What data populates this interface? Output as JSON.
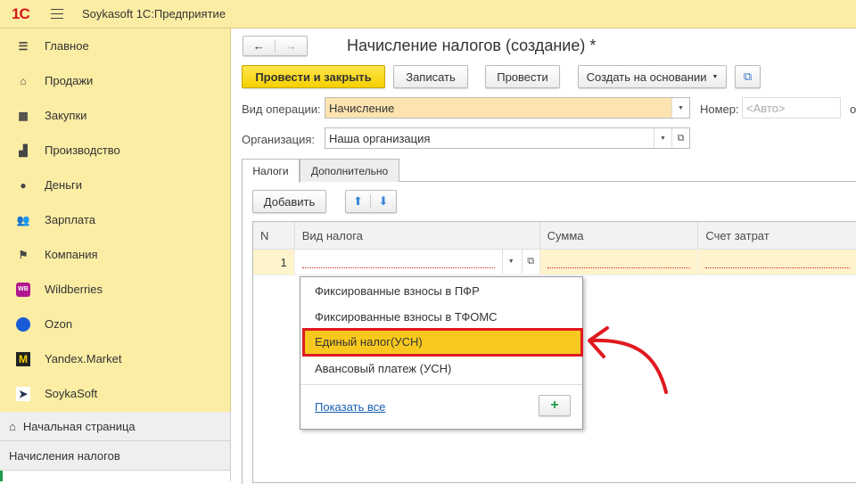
{
  "app": {
    "logo": "1С",
    "title": "Soykasoft 1С:Предприятие"
  },
  "sidebar": {
    "items": [
      {
        "label": "Главное",
        "icon": "menu-lines-icon"
      },
      {
        "label": "Продажи",
        "icon": "basket-icon"
      },
      {
        "label": "Закупки",
        "icon": "cart-icon"
      },
      {
        "label": "Производство",
        "icon": "factory-icon"
      },
      {
        "label": "Деньги",
        "icon": "ruble-coin-icon"
      },
      {
        "label": "Зарплата",
        "icon": "people-icon"
      },
      {
        "label": "Компания",
        "icon": "flag-icon"
      },
      {
        "label": "Wildberries",
        "icon": "wb-logo-icon",
        "badge": "WB"
      },
      {
        "label": "Ozon",
        "icon": "ozon-logo-icon"
      },
      {
        "label": "Yandex.Market",
        "icon": "yandex-market-logo-icon"
      },
      {
        "label": "SoykaSoft",
        "icon": "soykasoft-logo-icon"
      }
    ]
  },
  "bottom_nav": {
    "home": "Начальная страница",
    "open_tab": "Начисления налогов"
  },
  "form": {
    "title": "Начисление налогов (создание) *",
    "buttons": {
      "post_close": "Провести и закрыть",
      "save": "Записать",
      "post": "Провести",
      "create_based": "Создать на основании"
    },
    "operation_label": "Вид операции:",
    "operation_value": "Начисление",
    "number_label": "Номер:",
    "number_placeholder": "<Авто>",
    "date_label_cut": "о",
    "org_label": "Организация:",
    "org_value": "Наша организация",
    "tabs": [
      "Налоги",
      "Дополнительно"
    ],
    "add_button": "Добавить",
    "columns": [
      "N",
      "Вид налога",
      "Сумма",
      "Счет затрат"
    ],
    "rows": [
      {
        "n": "1",
        "tax": "",
        "sum": "",
        "account": ""
      }
    ]
  },
  "dropdown": {
    "items": [
      "Фиксированные взносы в ПФР",
      "Фиксированные взносы в ТФОМС",
      "Единый налог(УСН)",
      "Авансовый платеж (УСН)"
    ],
    "selected_index": 2,
    "show_all": "Показать все"
  },
  "colors": {
    "accent": "#f5d000",
    "sidebar": "#fbeda4",
    "highlight_border": "#e0191e"
  }
}
